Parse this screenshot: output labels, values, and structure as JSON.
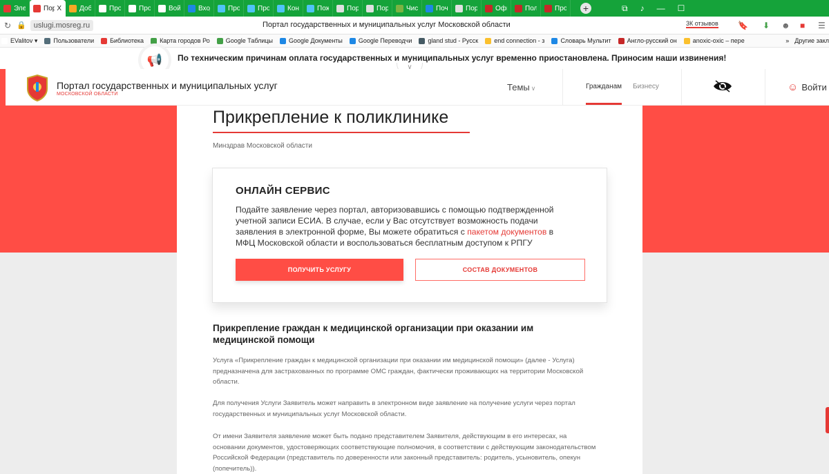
{
  "browser": {
    "tabs": [
      {
        "label": "Элект",
        "color": "#e53935"
      },
      {
        "label": "Пор",
        "color": "#e53935",
        "active": true
      },
      {
        "label": "Добро",
        "color": "#f9a825"
      },
      {
        "label": "Проек",
        "color": "#ffffff"
      },
      {
        "label": "Проек",
        "color": "#ffffff"
      },
      {
        "label": "Войти",
        "color": "#ffffff"
      },
      {
        "label": "Входя",
        "color": "#1e88e5"
      },
      {
        "label": "Проек",
        "color": "#4fc3f7"
      },
      {
        "label": "Просм",
        "color": "#4fc3f7"
      },
      {
        "label": "Конст",
        "color": "#4fc3f7"
      },
      {
        "label": "Пожал",
        "color": "#4fc3f7"
      },
      {
        "label": "Порта",
        "color": "#e0e0e0"
      },
      {
        "label": "Порта",
        "color": "#e0e0e0"
      },
      {
        "label": "Чисти",
        "color": "#7cb342"
      },
      {
        "label": "Почва",
        "color": "#1e88e5"
      },
      {
        "label": "Порта",
        "color": "#e0e0e0"
      },
      {
        "label": "Офици",
        "color": "#c62828"
      },
      {
        "label": "Получ",
        "color": "#c62828"
      },
      {
        "label": "Провс",
        "color": "#c62828"
      }
    ],
    "active_tab_close": "X",
    "new_tab": "+",
    "url": "uslugi.mosreg.ru",
    "page_title": "Портал государственных и муниципальных услуг Московской области",
    "reviews_badge": "3К отзывов",
    "bookmarks": [
      {
        "label": "EValitov ▾",
        "color": "#ffffff"
      },
      {
        "label": "Пользователи",
        "color": "#546e7a"
      },
      {
        "label": "Библиотека",
        "color": "#e53935"
      },
      {
        "label": "Карта городов Ро",
        "color": "#43a047"
      },
      {
        "label": "Google Таблицы",
        "color": "#43a047"
      },
      {
        "label": "Google Документы",
        "color": "#1e88e5"
      },
      {
        "label": "Google Переводчи",
        "color": "#1e88e5"
      },
      {
        "label": "gland stud - Русск",
        "color": "#455a64"
      },
      {
        "label": "end connection - з",
        "color": "#fbc02d"
      },
      {
        "label": "Словарь Мультит",
        "color": "#1e88e5"
      },
      {
        "label": "Англо-русский он",
        "color": "#c62828"
      },
      {
        "label": "anoxic-oxic – пере",
        "color": "#fbc02d"
      }
    ],
    "other_bookmarks": "Другие закл"
  },
  "notice": {
    "text": "По техническим причинам оплата государственных и муниципальных услуг временно приостановлена. Приносим наши извинения!"
  },
  "header": {
    "title": "Портал государственных и муниципальных услуг",
    "subtitle": "МОСКОВСКОЙ ОБЛАСТИ",
    "themes": "Темы",
    "tab_citizens": "Гражданам",
    "tab_business": "Бизнесу",
    "login": "Войти"
  },
  "main": {
    "title": "Прикрепление к поликлинике",
    "ministry": "Минздрав Московской области",
    "online": {
      "title": "ОНЛАЙН СЕРВИС",
      "text_before": "Подайте заявление через портал, авторизовавшись с помощью подтвержденной учетной записи ЕСИА. В случае, если у Вас отсутствует возможность подачи заявления в электронной форме, Вы можете обратиться с ",
      "link": "пакетом документов",
      "text_after": " в МФЦ Московской области и воспользоваться бесплатным доступом к РПГУ",
      "btn_get": "ПОЛУЧИТЬ УСЛУГУ",
      "btn_docs": "СОСТАВ ДОКУМЕНТОВ"
    },
    "section_title": "Прикрепление граждан к медицинской организации при оказании им медицинской помощи",
    "paragraphs": [
      "Услуга «Прикрепление граждан к медицинской организации при оказании им медицинской помощи» (далее - Услуга) предназначена для застрахованных по программе ОМС граждан, фактически проживающих на территории Московской области.",
      "Для получения Услуги Заявитель может направить в электронном виде заявление на получение услуги через портал государственных и муниципальных услуг Московской области.",
      "От имени Заявителя заявление может быть подано представителем Заявителя, действующим в его интересах, на основании документов, удостоверяющих соответствующие полномочия, в соответствии с действующим законодательством Российской Федерации (представитель по доверенности или законный представитель: родитель, усыновитель, опекун (попечитель))."
    ]
  },
  "colors": {
    "accent": "#ff4d45",
    "browser_green": "#15a33a"
  }
}
